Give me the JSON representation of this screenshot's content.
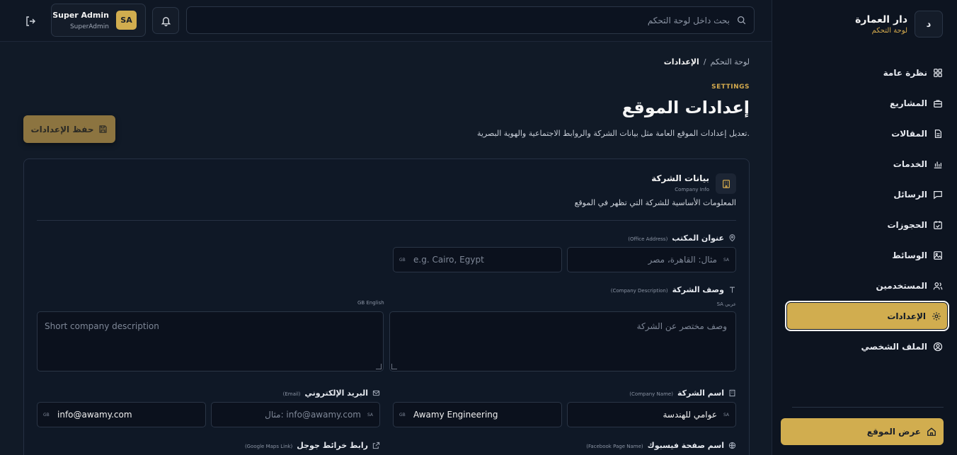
{
  "brand": {
    "logo_letter": "د",
    "name": "دار العمارة",
    "subtitle": "لوحة التحكم"
  },
  "sidebar": {
    "items": [
      {
        "label": "نظرة عامة",
        "icon": "grid-icon"
      },
      {
        "label": "المشاريع",
        "icon": "briefcase-icon"
      },
      {
        "label": "المقالات",
        "icon": "document-icon"
      },
      {
        "label": "الخدمات",
        "icon": "bar-chart-icon"
      },
      {
        "label": "الرسائل",
        "icon": "message-icon"
      },
      {
        "label": "الحجوزات",
        "icon": "calendar-check-icon"
      },
      {
        "label": "الوسائط",
        "icon": "image-icon"
      },
      {
        "label": "المستخدمين",
        "icon": "users-icon"
      },
      {
        "label": "الإعدادات",
        "icon": "gear-icon",
        "active": true
      },
      {
        "label": "الملف الشخصي",
        "icon": "user-circle-icon"
      }
    ],
    "view_site": "عرض الموقع"
  },
  "topbar": {
    "search_placeholder": "بحث داخل لوحة التحكم",
    "user_name": "Super Admin",
    "user_role": "SuperAdmin",
    "avatar_initials": "SA"
  },
  "breadcrumb": {
    "root": "لوحة التحكم",
    "separator": "/",
    "current": "الإعدادات"
  },
  "header": {
    "eyebrow": "SETTINGS",
    "title": "إعدادات الموقع",
    "description": "تعديل إعدادات الموقع العامة مثل بيانات الشركة والروابط الاجتماعية والهوية البصرية.",
    "save_label": "حفظ الإعدادات"
  },
  "card": {
    "title": "بيانات الشركة",
    "subtitle": "Company Info",
    "description": "المعلومات الأساسية للشركة التي تظهر في الموقع"
  },
  "fields": {
    "office_address": {
      "label": "عنوان المكتب",
      "en": "(Office Address)",
      "ar_tag": "SA",
      "ar_placeholder": "مثال: القاهرة، مصر",
      "en_tag": "GB",
      "en_placeholder": "e.g. Cairo, Egypt"
    },
    "company_description": {
      "label": "وصف الشركة",
      "en": "(Company Description)",
      "ar_caption": "SA عربي",
      "en_caption": "GB English",
      "ar_placeholder": "وصف مختصر عن الشركة",
      "en_placeholder": "Short company description"
    },
    "company_name": {
      "label": "اسم الشركة",
      "en": "(Company Name)",
      "ar_tag": "SA",
      "ar_value": "عوامي للهندسة",
      "en_tag": "GB",
      "en_value": "Awamy Engineering"
    },
    "email": {
      "label": "البريد الإلكتروني",
      "en": "(Email)",
      "ar_tag": "SA",
      "ar_placeholder": "مثال: info@awamy.com",
      "en_tag": "GB",
      "en_value": "info@awamy.com"
    },
    "facebook": {
      "label": "اسم صفحة فيسبوك",
      "en": "(Facebook Page Name)"
    },
    "google_maps": {
      "label": "رابط خرائط جوجل",
      "en": "(Google Maps Link)"
    }
  },
  "colors": {
    "accent": "#d1ad4f",
    "background": "#111a27",
    "sidebar": "#0d1420"
  }
}
